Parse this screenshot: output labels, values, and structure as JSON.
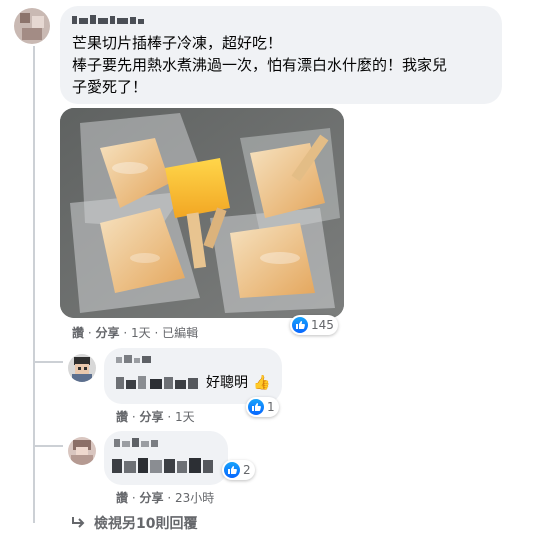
{
  "main_comment": {
    "text_line1": "芒果切片插棒子冷凍，超好吃！",
    "text_line2": "棒子要先用熱水煮沸過一次，怕有漂白水什麼的！我家兒",
    "text_line3": "子愛死了！",
    "actions": {
      "like": "讚",
      "reply": "分享",
      "time": "1天",
      "edited": "已編輯",
      "sep": "·"
    },
    "reaction_count": "145"
  },
  "reply1": {
    "text_suffix": "好聰明",
    "emoji": "👍",
    "actions": {
      "like": "讚",
      "reply": "分享",
      "time": "1天",
      "sep": "·"
    },
    "reaction_count": "1"
  },
  "reply2": {
    "actions": {
      "like": "讚",
      "reply": "分享",
      "time": "23小時",
      "sep": "·"
    },
    "reaction_count": "2"
  },
  "more_replies": {
    "label": "檢視另10則回覆",
    "icon": "reply-arrow-icon"
  },
  "colors": {
    "bubble": "#f0f2f5",
    "meta": "#65676b",
    "like_blue": "#0866ff"
  }
}
